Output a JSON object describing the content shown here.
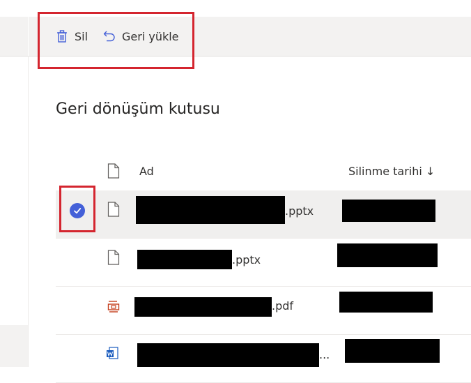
{
  "toolbar": {
    "delete_label": "Sil",
    "restore_label": "Geri yükle"
  },
  "page": {
    "title": "Geri dönüşüm kutusu"
  },
  "table": {
    "columns": {
      "name": "Ad",
      "deleted_date": "Silinme tarihi ↓"
    },
    "rows": [
      {
        "ext": ".pptx",
        "icon": "file-icon",
        "selected": true
      },
      {
        "ext": ".pptx",
        "icon": "file-icon",
        "selected": false
      },
      {
        "ext": ".pdf",
        "icon": "pdf-file-icon",
        "selected": false
      },
      {
        "ext": "...",
        "icon": "word-file-icon",
        "selected": false
      }
    ]
  },
  "colors": {
    "highlight": "#d4252f",
    "accent": "#4460d8",
    "pdf_icon": "#c43e1c",
    "word_icon": "#185abd"
  }
}
